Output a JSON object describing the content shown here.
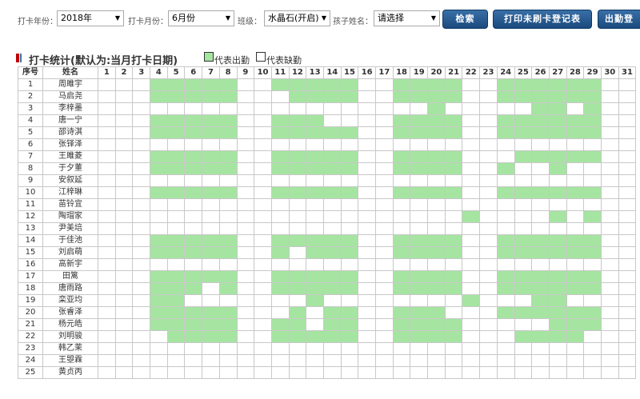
{
  "filters": {
    "year_label": "打卡年份：",
    "year_value": "2018年",
    "month_label": "打卡月份：",
    "month_value": "6月份",
    "class_label": "班级：",
    "class_value": "水晶石(开启)",
    "child_label": "孩子姓名：",
    "child_value": "请选择"
  },
  "buttons": {
    "search": "检索",
    "print": "打印未刷卡登记表",
    "attendance": "出勤登"
  },
  "section": {
    "title": "打卡统计(默认为:当月打卡日期)",
    "legend_present": "代表出勤",
    "legend_absent": "代表缺勤"
  },
  "colors": {
    "present": "#a5e5a1",
    "absent": "#ffffff",
    "button": "#1a4a7e",
    "title_marker": "#c00000"
  },
  "table": {
    "idx_header": "序号",
    "name_header": "姓名",
    "days": [
      "1",
      "2",
      "3",
      "4",
      "5",
      "6",
      "7",
      "8",
      "9",
      "10",
      "11",
      "12",
      "13",
      "14",
      "15",
      "16",
      "17",
      "18",
      "19",
      "20",
      "21",
      "22",
      "23",
      "24",
      "25",
      "26",
      "27",
      "28",
      "29",
      "30",
      "31"
    ],
    "rows": [
      {
        "idx": "1",
        "name": "周雎宇",
        "att": "0001111100111110011110011111100"
      },
      {
        "idx": "2",
        "name": "马启尧",
        "att": "0001111100011110011110011111100"
      },
      {
        "idx": "3",
        "name": "李梓墨",
        "att": "0000000000000000000100000110100"
      },
      {
        "idx": "4",
        "name": "唐一宁",
        "att": "0001111100111000011110011111100"
      },
      {
        "idx": "5",
        "name": "邵诗淇",
        "att": "0001111100111110011110011111100"
      },
      {
        "idx": "6",
        "name": "张铎泽",
        "att": "0000000000000000000000000000000"
      },
      {
        "idx": "7",
        "name": "王雎菱",
        "att": "0001111100111110011110001111100"
      },
      {
        "idx": "8",
        "name": "于夕董",
        "att": "0001111100111110011110010010000"
      },
      {
        "idx": "9",
        "name": "安叙延",
        "att": "0000000000000000000000000000000"
      },
      {
        "idx": "10",
        "name": "江梓琳",
        "att": "0001111100111110011110011111100"
      },
      {
        "idx": "11",
        "name": "苗铃宜",
        "att": "0000000000000000000000000000000"
      },
      {
        "idx": "12",
        "name": "陶瑁家",
        "att": "0000000000000000000001000010100"
      },
      {
        "idx": "13",
        "name": "尹美培",
        "att": "0000000000000000000000000000000"
      },
      {
        "idx": "14",
        "name": "于佳池",
        "att": "0001111100111110011110011111100"
      },
      {
        "idx": "15",
        "name": "刘启萌",
        "att": "0001111100101110011110011111100"
      },
      {
        "idx": "16",
        "name": "高新宇",
        "att": "0000000000000000000000000000000"
      },
      {
        "idx": "17",
        "name": "田篱",
        "att": "0001111100111110011110011111100"
      },
      {
        "idx": "18",
        "name": "唐雨路",
        "att": "0001110100111110011110011111100"
      },
      {
        "idx": "19",
        "name": "栾亚均",
        "att": "0001100000001000000001000110000"
      },
      {
        "idx": "20",
        "name": "张睿泽",
        "att": "0001111100010110011100011111100"
      },
      {
        "idx": "21",
        "name": "杨元皓",
        "att": "0001111100110110011110000011100"
      },
      {
        "idx": "22",
        "name": "刘明骏",
        "att": "0000111100111110011110001111000"
      },
      {
        "idx": "23",
        "name": "韩乙茉",
        "att": "0000000000000000000000000000000"
      },
      {
        "idx": "24",
        "name": "王曌霖",
        "att": "0000000000000000000000000000000"
      },
      {
        "idx": "25",
        "name": "黄贞丙",
        "att": "0000000000000000000000000000000"
      }
    ]
  }
}
